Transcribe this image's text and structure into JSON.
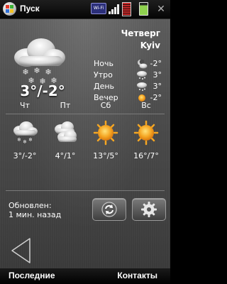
{
  "status_bar": {
    "start_label": "Пуск",
    "wifi_label": "Wi-Fi",
    "close_glyph": "✕"
  },
  "weather": {
    "day_name": "Четверг",
    "city": "Kyiv",
    "today_temp": "3°/-2°",
    "today_icon": "snow-cloud-icon",
    "periods": [
      {
        "label": "Ночь",
        "temp": "-2°",
        "icon": "moon-cloud-icon"
      },
      {
        "label": "Утро",
        "temp": "3°",
        "icon": "snow-cloud-icon"
      },
      {
        "label": "День",
        "temp": "3°",
        "icon": "snow-cloud-icon"
      },
      {
        "label": "Вечер",
        "temp": "-2°",
        "icon": "sun-icon"
      }
    ],
    "forecast": [
      {
        "day": "Чт",
        "temp": "3°/-2°",
        "icon": "snow-cloud-icon"
      },
      {
        "day": "Пт",
        "temp": "4°/1°",
        "icon": "cloudy-icon"
      },
      {
        "day": "Сб",
        "temp": "13°/5°",
        "icon": "sun-icon"
      },
      {
        "day": "Вс",
        "temp": "16°/7°",
        "icon": "sun-icon"
      }
    ]
  },
  "update": {
    "label": "Обновлен:",
    "value": "1 мин. назад",
    "refresh_icon": "refresh-icon",
    "settings_icon": "gear-icon"
  },
  "softkeys": {
    "left": "Последние",
    "right": "Контакты"
  },
  "colors": {
    "sun": "#f5a623",
    "background": "#4a4a4a"
  }
}
